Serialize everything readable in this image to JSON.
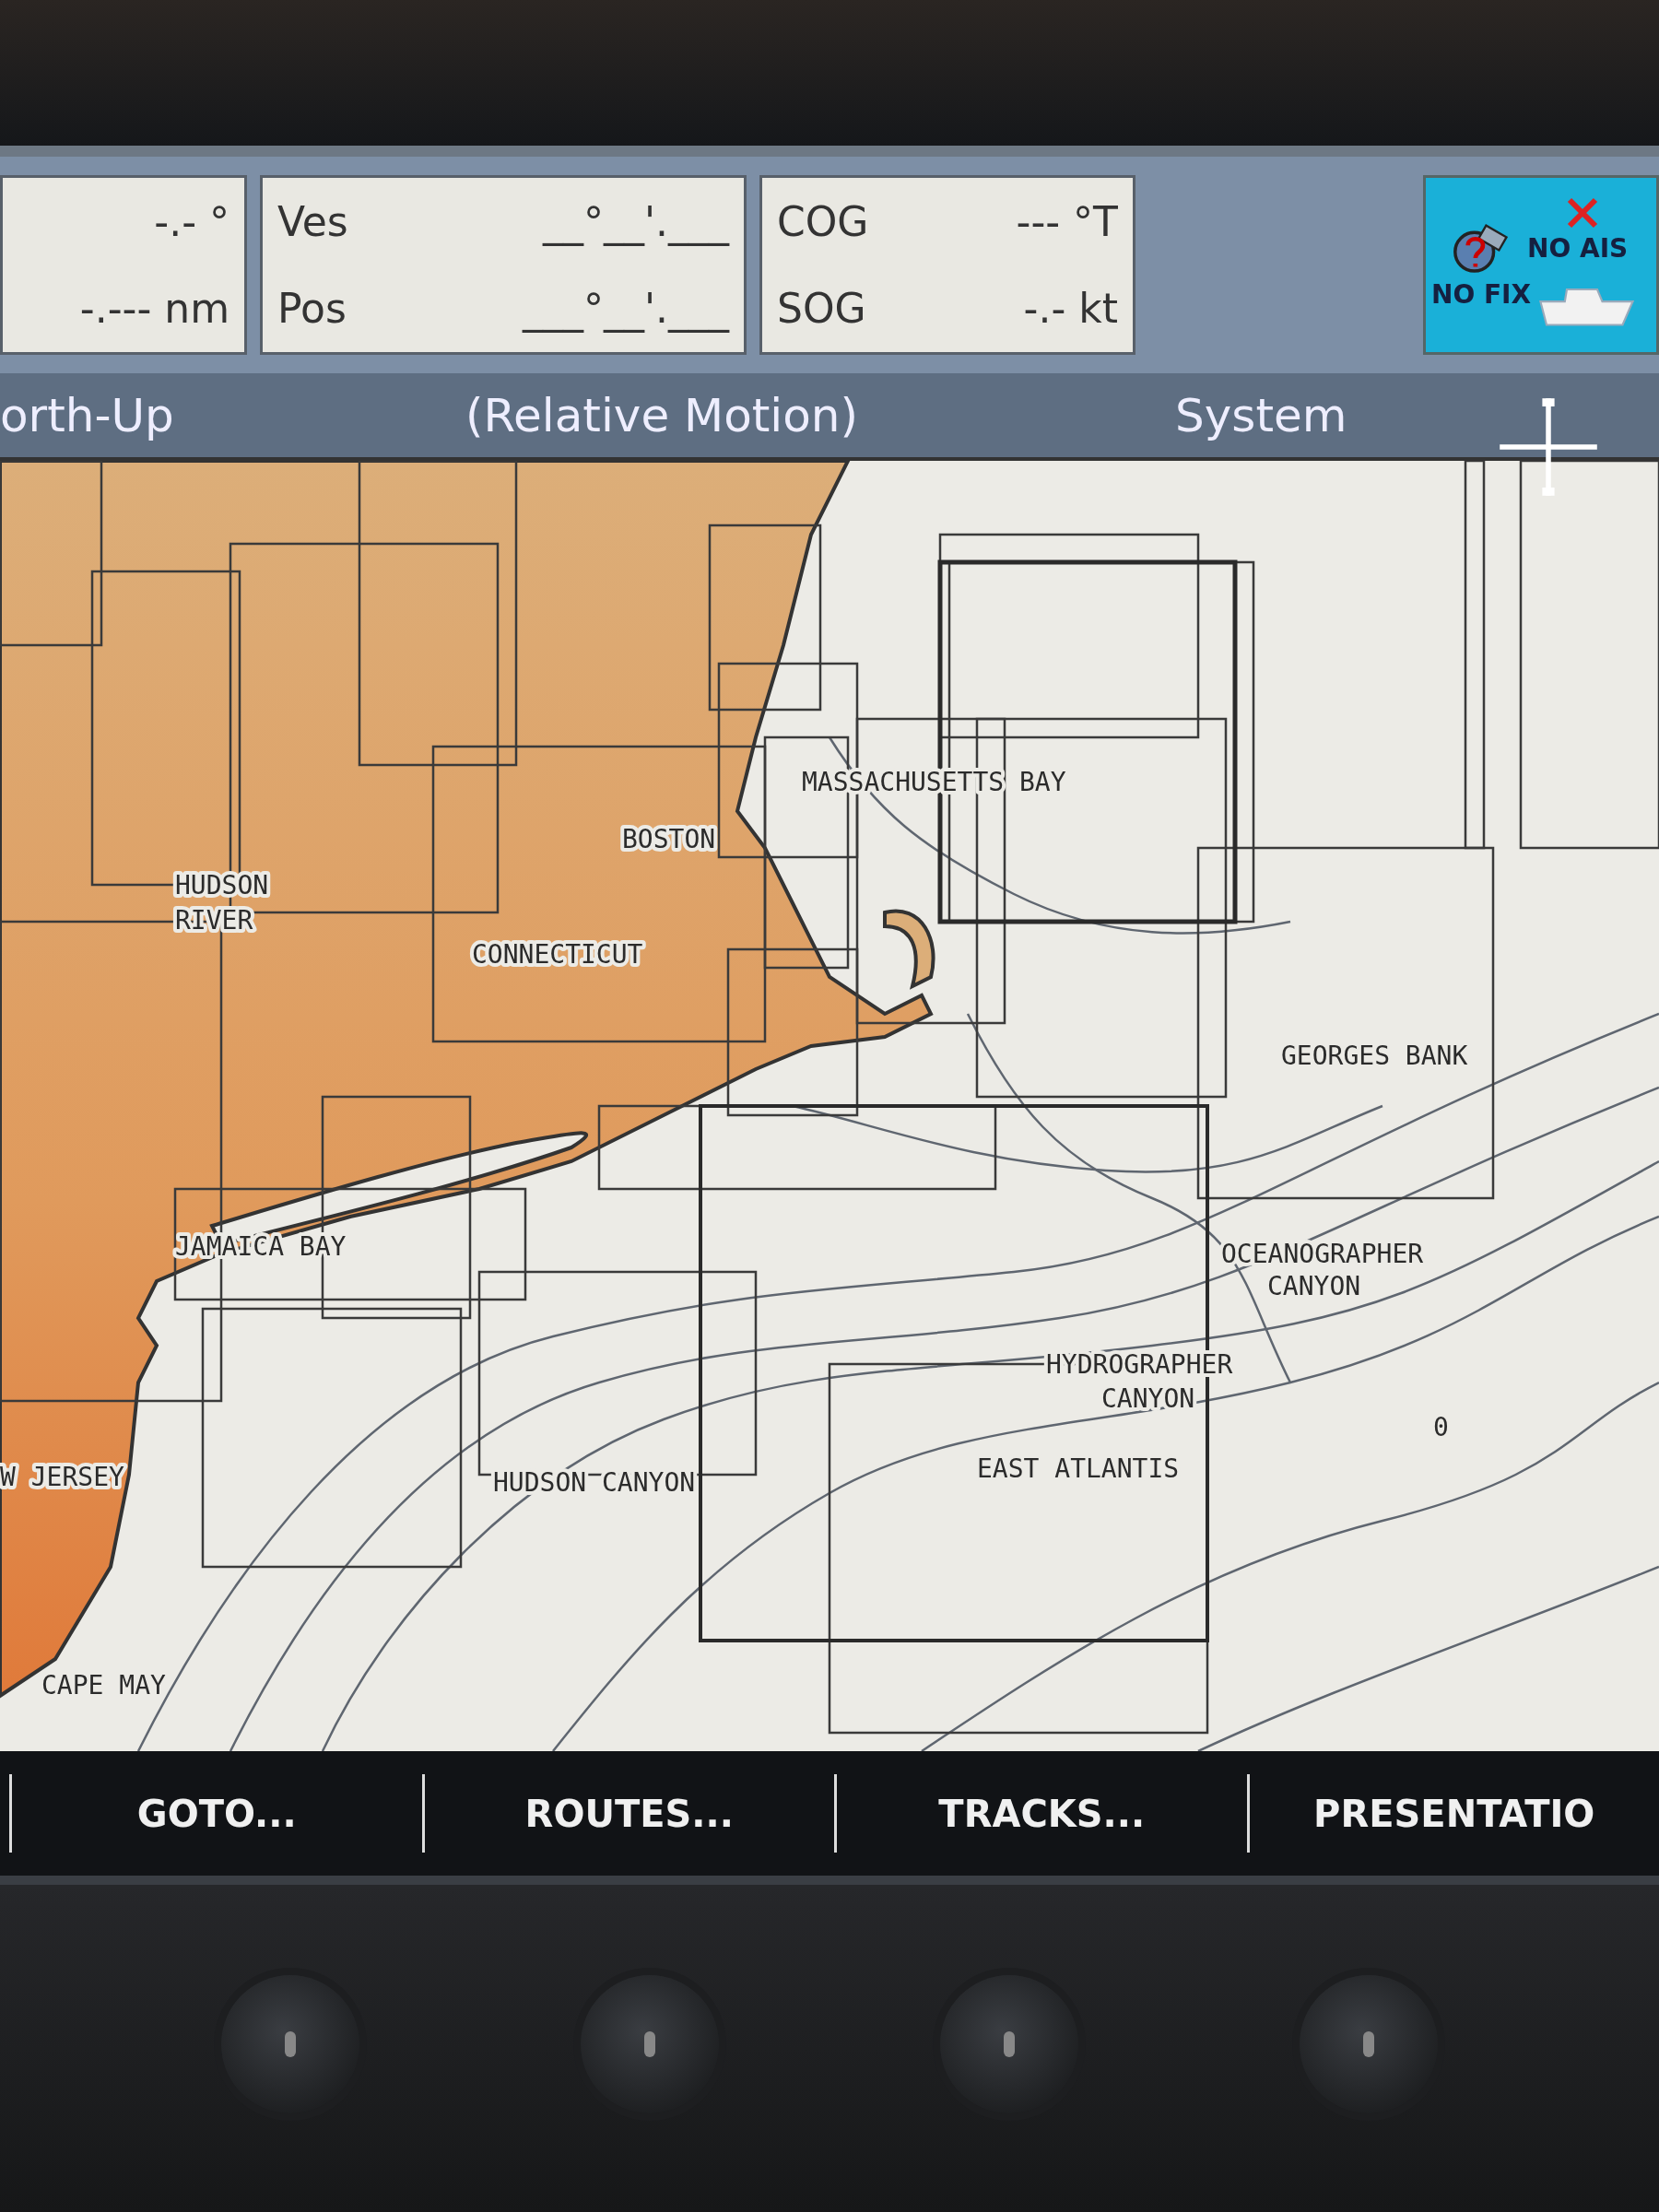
{
  "data_bar": {
    "panel_1": {
      "rows": [
        {
          "value": "-.- °"
        },
        {
          "value": "-.--- nm"
        }
      ]
    },
    "panel_2": {
      "rows": [
        {
          "label": "Ves",
          "value": "__°__'.___"
        },
        {
          "label": "Pos",
          "value": "___°__'.___"
        }
      ]
    },
    "panel_3": {
      "rows": [
        {
          "label": "COG",
          "value": "--- °T"
        },
        {
          "label": "SOG",
          "value": "-.- kt"
        }
      ]
    },
    "status": {
      "gps": "NO FIX",
      "ais": "NO AIS"
    }
  },
  "menu_bar": {
    "items": [
      "orth-Up",
      "(Relative Motion)",
      "System"
    ]
  },
  "chart": {
    "labels": [
      {
        "text": "MASSACHUSETTS BAY"
      },
      {
        "text": "BOSTON"
      },
      {
        "text": "HUDSON"
      },
      {
        "text": "RIVER"
      },
      {
        "text": "CONNECTICUT"
      },
      {
        "text": "GEORGES BANK"
      },
      {
        "text": "OCEANOGRAPHER"
      },
      {
        "text": "CANYON"
      },
      {
        "text": "HYDROGRAPHER"
      },
      {
        "text": "CANYON"
      },
      {
        "text": "JAMAICA BAY"
      },
      {
        "text": "W JERSEY"
      },
      {
        "text": "HUDSON CANYON"
      },
      {
        "text": "EAST ATLANTIS"
      },
      {
        "text": "CAPE MAY"
      },
      {
        "text": "0"
      }
    ]
  },
  "soft_keys": [
    "GOTO...",
    "ROUTES...",
    "TRACKS...",
    "PRESENTATIO"
  ]
}
